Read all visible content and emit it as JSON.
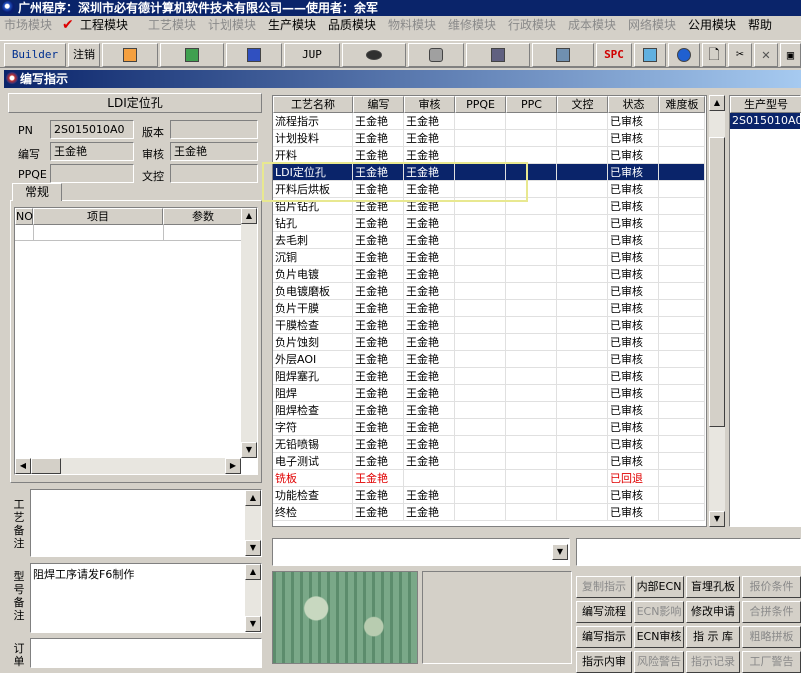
{
  "window": {
    "title": "广州程序：深圳市必有德计算机软件技术有限公司——使用者：余军"
  },
  "menu": [
    {
      "label": "市场模块",
      "enabled": false
    },
    {
      "label": "工程模块",
      "enabled": true,
      "checked": true
    },
    {
      "label": "工艺模块",
      "enabled": false
    },
    {
      "label": "计划模块",
      "enabled": false
    },
    {
      "label": "生产模块",
      "enabled": true
    },
    {
      "label": "品质模块",
      "enabled": true
    },
    {
      "label": "物料模块",
      "enabled": false
    },
    {
      "label": "维修模块",
      "enabled": false
    },
    {
      "label": "行政模块",
      "enabled": false
    },
    {
      "label": "成本模块",
      "enabled": false
    },
    {
      "label": "网络模块",
      "enabled": false
    },
    {
      "label": "公用模块",
      "enabled": true
    },
    {
      "label": "帮助",
      "enabled": true
    }
  ],
  "toolbar": {
    "builder": "Builder",
    "logout": "注销",
    "jup": "JUP",
    "spc": "SPC"
  },
  "subwindow": {
    "title": "编写指示"
  },
  "left": {
    "heading": "LDI定位孔",
    "pn_label": "PN",
    "pn_value": "2S015010A0",
    "version_label": "版本",
    "version_value": "",
    "author_label": "编写",
    "author_value": "王金艳",
    "reviewer_label": "审核",
    "reviewer_value": "王金艳",
    "ppqe_label": "PPQE",
    "ppqe_value": "",
    "control_label": "文控",
    "control_value": "",
    "tab_label": "常规",
    "mini_headers": [
      "NO",
      "项目",
      "参数"
    ],
    "process_note_label": "工艺备注",
    "model_note_label": "型号备注",
    "model_note_value": "阻焊工序请发F6制作",
    "order_note_label": "订单"
  },
  "grid": {
    "headers": [
      "工艺名称",
      "编写",
      "审核",
      "PPQE",
      "PPC",
      "文控",
      "状态",
      "难度板"
    ],
    "rows": [
      {
        "name": "流程指示",
        "author": "王金艳",
        "reviewer": "王金艳",
        "status": "已审核"
      },
      {
        "name": "计划投料",
        "author": "王金艳",
        "reviewer": "王金艳",
        "status": "已审核"
      },
      {
        "name": "开料",
        "author": "王金艳",
        "reviewer": "王金艳",
        "status": "已审核"
      },
      {
        "name": "LDI定位孔",
        "author": "王金艳",
        "reviewer": "王金艳",
        "status": "已审核",
        "selected": true
      },
      {
        "name": "开料后烘板",
        "author": "王金艳",
        "reviewer": "王金艳",
        "status": "已审核"
      },
      {
        "name": "铝片钻孔",
        "author": "王金艳",
        "reviewer": "王金艳",
        "status": "已审核"
      },
      {
        "name": "钻孔",
        "author": "王金艳",
        "reviewer": "王金艳",
        "status": "已审核"
      },
      {
        "name": "去毛刺",
        "author": "王金艳",
        "reviewer": "王金艳",
        "status": "已审核"
      },
      {
        "name": "沉铜",
        "author": "王金艳",
        "reviewer": "王金艳",
        "status": "已审核"
      },
      {
        "name": "负片电镀",
        "author": "王金艳",
        "reviewer": "王金艳",
        "status": "已审核"
      },
      {
        "name": "负电镀磨板",
        "author": "王金艳",
        "reviewer": "王金艳",
        "status": "已审核"
      },
      {
        "name": "负片干膜",
        "author": "王金艳",
        "reviewer": "王金艳",
        "status": "已审核"
      },
      {
        "name": "干膜检查",
        "author": "王金艳",
        "reviewer": "王金艳",
        "status": "已审核"
      },
      {
        "name": "负片蚀刻",
        "author": "王金艳",
        "reviewer": "王金艳",
        "status": "已审核"
      },
      {
        "name": "外层AOI",
        "author": "王金艳",
        "reviewer": "王金艳",
        "status": "已审核"
      },
      {
        "name": "阻焊塞孔",
        "author": "王金艳",
        "reviewer": "王金艳",
        "status": "已审核"
      },
      {
        "name": "阻焊",
        "author": "王金艳",
        "reviewer": "王金艳",
        "status": "已审核"
      },
      {
        "name": "阻焊检查",
        "author": "王金艳",
        "reviewer": "王金艳",
        "status": "已审核"
      },
      {
        "name": "字符",
        "author": "王金艳",
        "reviewer": "王金艳",
        "status": "已审核"
      },
      {
        "name": "无铅喷锡",
        "author": "王金艳",
        "reviewer": "王金艳",
        "status": "已审核"
      },
      {
        "name": "电子测试",
        "author": "王金艳",
        "reviewer": "王金艳",
        "status": "已审核"
      },
      {
        "name": "铣板",
        "author": "王金艳",
        "reviewer": "",
        "status": "已回退",
        "red": true
      },
      {
        "name": "功能检查",
        "author": "王金艳",
        "reviewer": "王金艳",
        "status": "已审核"
      },
      {
        "name": "终检",
        "author": "王金艳",
        "reviewer": "王金艳",
        "status": "已审核"
      }
    ]
  },
  "model_panel": {
    "header": "生产型号",
    "items": [
      "2S015010A0"
    ]
  },
  "actions": [
    {
      "label": "复制指示",
      "enabled": false
    },
    {
      "label": "内部ECN",
      "enabled": true
    },
    {
      "label": "盲埋孔板",
      "enabled": true
    },
    {
      "label": "报价条件",
      "enabled": false
    },
    {
      "label": "编写流程",
      "enabled": true
    },
    {
      "label": "ECN影响",
      "enabled": false
    },
    {
      "label": "修改申请",
      "enabled": true
    },
    {
      "label": "合拼条件",
      "enabled": false
    },
    {
      "label": "编写指示",
      "enabled": true
    },
    {
      "label": "ECN审核",
      "enabled": true
    },
    {
      "label": "指 示 库",
      "enabled": true
    },
    {
      "label": "粗略拼板",
      "enabled": false
    },
    {
      "label": "指示内审",
      "enabled": true
    },
    {
      "label": "风险警告",
      "enabled": false
    },
    {
      "label": "指示记录",
      "enabled": false
    },
    {
      "label": "工厂警告",
      "enabled": false
    }
  ],
  "colors": {
    "selection": "#0a246a",
    "highlight_box": "#e8e890",
    "returned": "#e00000"
  }
}
